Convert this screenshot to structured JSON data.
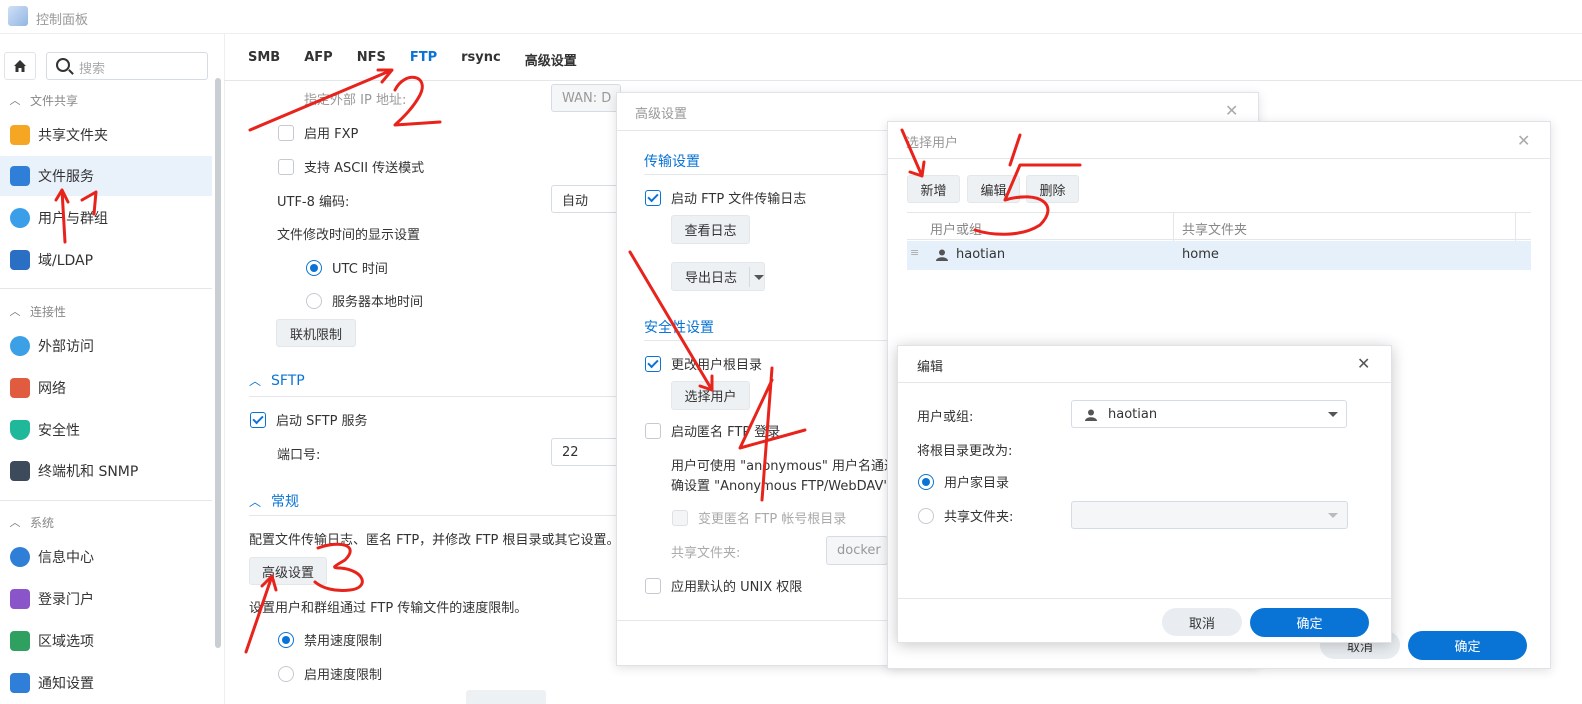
{
  "app": {
    "title": "控制面板",
    "search_placeholder": "搜索"
  },
  "sidebar": {
    "sections": [
      {
        "label": "文件共享",
        "items": [
          {
            "label": "共享文件夹",
            "icon": "folder-icon",
            "color": "#f5a623"
          },
          {
            "label": "文件服务",
            "icon": "file-services-icon",
            "color": "#2f7fd8"
          },
          {
            "label": "用户与群组",
            "icon": "users-icon",
            "color": "#3a9fe8"
          },
          {
            "label": "域/LDAP",
            "icon": "domain-icon",
            "color": "#2a6fc4"
          }
        ]
      },
      {
        "label": "连接性",
        "items": [
          {
            "label": "外部访问",
            "icon": "external-access-icon",
            "color": "#3ba0e6"
          },
          {
            "label": "网络",
            "icon": "network-home-icon",
            "color": "#e05b3f"
          },
          {
            "label": "安全性",
            "icon": "shield-icon",
            "color": "#1fb89a"
          },
          {
            "label": "终端机和 SNMP",
            "icon": "terminal-icon",
            "color": "#3d4a5c"
          }
        ]
      },
      {
        "label": "系统",
        "items": [
          {
            "label": "信息中心",
            "icon": "info-icon",
            "color": "#2f7fd8"
          },
          {
            "label": "登录门户",
            "icon": "login-portal-icon",
            "color": "#8a55c9"
          },
          {
            "label": "区域选项",
            "icon": "region-icon",
            "color": "#2fa060"
          },
          {
            "label": "通知设置",
            "icon": "notification-icon",
            "color": "#2f7fd8"
          }
        ]
      }
    ]
  },
  "tabs": [
    "SMB",
    "AFP",
    "NFS",
    "FTP",
    "rsync",
    "高级设置"
  ],
  "ftp_panel": {
    "ext_ip_label": "指定外部 IP 地址:",
    "ext_ip_value": "WAN: D",
    "enable_fxp": "启用 FXP",
    "ascii_mode": "支持 ASCII 传送模式",
    "utf8_label": "UTF-8 编码:",
    "utf8_value": "自动",
    "file_time_label": "文件修改时间的显示设置",
    "utc_time": "UTC 时间",
    "server_local_time": "服务器本地时间",
    "conn_limit_button": "联机限制",
    "sftp_title": "SFTP",
    "enable_sftp": "启动 SFTP 服务",
    "port_label": "端口号:",
    "port_value": "22",
    "general_title": "常规",
    "general_desc": "配置文件传输日志、匿名 FTP，并修改 FTP 根目录或其它设置。",
    "advanced_button": "高级设置",
    "speed_desc": "设置用户和群组通过 FTP 传输文件的速度限制。",
    "disable_speed_limit": "禁用速度限制",
    "enable_speed_limit": "启用速度限制"
  },
  "advanced_dialog": {
    "title": "高级设置",
    "transfer_section": "传输设置",
    "enable_ftp_log": "启动 FTP 文件传输日志",
    "view_log_button": "查看日志",
    "export_log_button": "导出日志",
    "security_section": "安全性设置",
    "change_user_root": "更改用户根目录",
    "select_user_button": "选择用户",
    "enable_anon_ftp": "启动匿名 FTP 登录",
    "anon_desc_1": "用户可使用 \"anonymous\" 用户名通过",
    "anon_desc_2": "确设置 \"Anonymous FTP/WebDAV\"",
    "change_anon_root": "变更匿名 FTP 帐号根目录",
    "shared_folder_label": "共享文件夹:",
    "shared_folder_value": "docker",
    "apply_unix_perm": "应用默认的 UNIX 权限"
  },
  "select_user_dialog": {
    "title": "选择用户",
    "add_button": "新增",
    "edit_button": "编辑",
    "delete_button": "删除",
    "col_user": "用户或组",
    "col_share": "共享文件夹",
    "rows": [
      {
        "user": "haotian",
        "share": "home"
      }
    ],
    "cancel_button": "取消",
    "ok_button": "确定"
  },
  "edit_dialog": {
    "title": "编辑",
    "user_label": "用户或组:",
    "user_value": "haotian",
    "change_root_label": "将根目录更改为:",
    "user_home": "用户家目录",
    "shared_folder": "共享文件夹:",
    "cancel_button": "取消",
    "ok_button": "确定"
  },
  "annotations": {
    "color": "#e8231b",
    "labels": [
      "1",
      "2",
      "3",
      "4",
      "5"
    ]
  }
}
